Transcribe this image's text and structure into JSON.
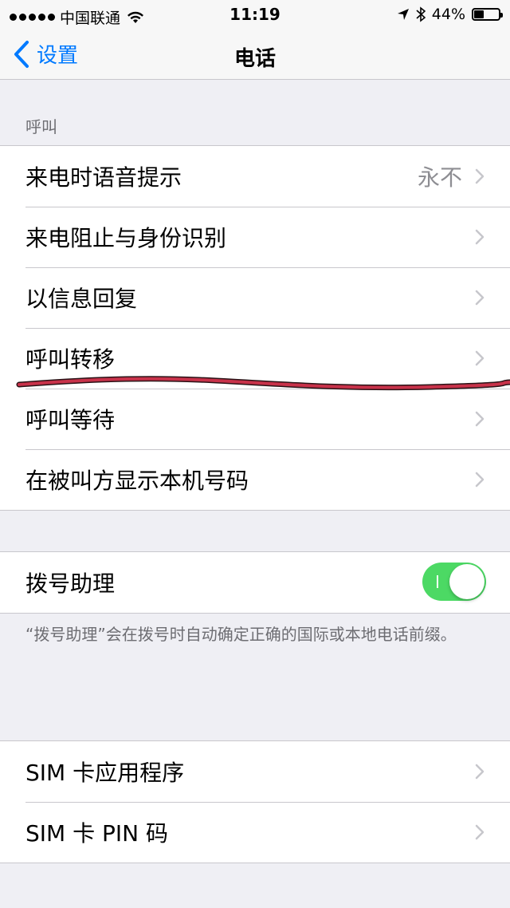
{
  "status_bar": {
    "carrier": "中国联通",
    "time": "11:19",
    "battery_percent": "44%",
    "battery_level": 0.44
  },
  "nav": {
    "back_label": "设置",
    "title": "电话"
  },
  "sections": {
    "calls_header": "呼叫",
    "calls_items": [
      {
        "label": "来电时语音提示",
        "value": "永不"
      },
      {
        "label": "来电阻止与身份识别"
      },
      {
        "label": "以信息回复"
      },
      {
        "label": "呼叫转移"
      },
      {
        "label": "呼叫等待"
      },
      {
        "label": "在被叫方显示本机号码"
      }
    ],
    "dial_assist": {
      "label": "拨号助理",
      "enabled": true,
      "footnote": "“拨号助理”会在拨号时自动确定正确的国际或本地电话前缀。"
    },
    "sim_items": [
      {
        "label": "SIM 卡应用程序"
      },
      {
        "label": "SIM 卡 PIN 码"
      }
    ]
  },
  "colors": {
    "accent": "#007aff",
    "toggle_on": "#4cd964",
    "annotation": "#c8324a"
  }
}
